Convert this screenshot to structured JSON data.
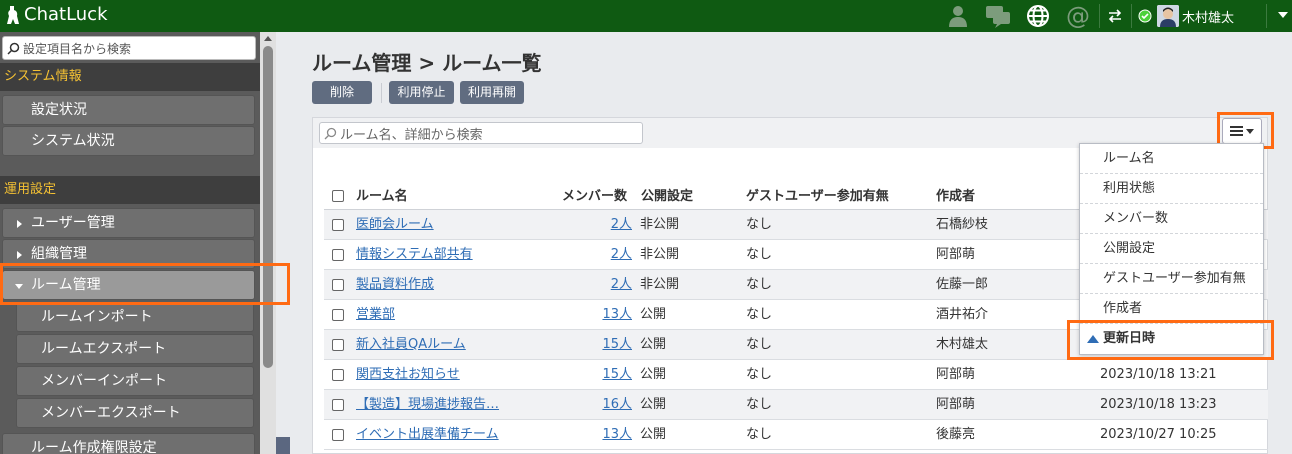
{
  "app": {
    "name": "ChatLuck"
  },
  "user": {
    "name": "木村雄太"
  },
  "sidebar": {
    "search_placeholder": "設定項目名から検索",
    "section_system": "システム情報",
    "items_system": [
      "設定状況",
      "システム状況"
    ],
    "section_ops": "運用設定",
    "user_mgmt": "ユーザー管理",
    "org_mgmt": "組織管理",
    "room_mgmt": "ルーム管理",
    "room_sub": [
      "ルームインポート",
      "ルームエクスポート",
      "メンバーインポート",
      "メンバーエクスポート"
    ],
    "room_perm": "ルーム作成権限設定"
  },
  "main": {
    "title": "ルーム管理 > ルーム一覧",
    "buttons": {
      "delete": "削除",
      "suspend": "利用停止",
      "resume": "利用再開"
    },
    "search_placeholder": "ルーム名、詳細から検索",
    "columns": {
      "name": "ルーム名",
      "members": "メンバー数",
      "visibility": "公開設定",
      "guest": "ゲストユーザー参加有無",
      "creator": "作成者"
    },
    "rows": [
      {
        "name": "医師会ルーム",
        "members": "2人",
        "visibility": "非公開",
        "guest": "なし",
        "creator": "石橋紗枝",
        "updated": ""
      },
      {
        "name": "情報システム部共有",
        "members": "2人",
        "visibility": "非公開",
        "guest": "なし",
        "creator": "阿部萌",
        "updated": ""
      },
      {
        "name": "製品資料作成",
        "members": "2人",
        "visibility": "非公開",
        "guest": "なし",
        "creator": "佐藤一郎",
        "updated": ""
      },
      {
        "name": "営業部",
        "members": "13人",
        "visibility": "公開",
        "guest": "なし",
        "creator": "酒井祐介",
        "updated": ""
      },
      {
        "name": "新入社員QAルーム",
        "members": "15人",
        "visibility": "公開",
        "guest": "なし",
        "creator": "木村雄太",
        "updated": ""
      },
      {
        "name": "関西支社お知らせ",
        "members": "15人",
        "visibility": "公開",
        "guest": "なし",
        "creator": "阿部萌",
        "updated": "2023/10/18 13:21"
      },
      {
        "name": "【製造】現場進捗報告…",
        "members": "16人",
        "visibility": "公開",
        "guest": "なし",
        "creator": "阿部萌",
        "updated": "2023/10/18 13:23"
      },
      {
        "name": "イベント出展準備チーム",
        "members": "13人",
        "visibility": "公開",
        "guest": "なし",
        "creator": "後藤亮",
        "updated": "2023/10/27 10:25"
      }
    ],
    "column_menu": {
      "items": [
        "ルーム名",
        "利用状態",
        "メンバー数",
        "公開設定",
        "ゲストユーザー参加有無",
        "作成者"
      ],
      "selected": "更新日時"
    }
  },
  "colors": {
    "topbar": "#0f5a12",
    "accent_highlight": "#ff6a13",
    "link": "#2f6db5",
    "section_label": "#f6c233"
  }
}
